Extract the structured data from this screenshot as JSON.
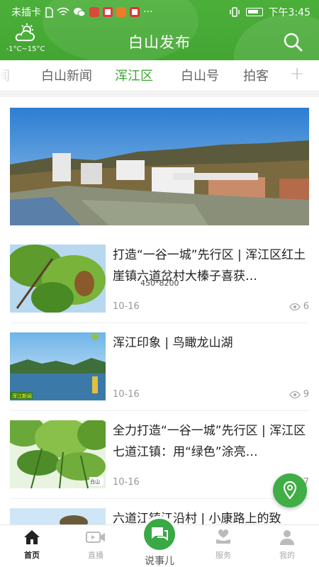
{
  "status_bar": {
    "carrier": "未插卡",
    "dots": "···",
    "time": "下午3:45"
  },
  "weather": {
    "icon": "cloud-sun-icon",
    "temp_range": "-1°C~15°C"
  },
  "header": {
    "title": "白山发布"
  },
  "tabs": {
    "items": [
      {
        "label": "闻"
      },
      {
        "label": "白山新闻"
      },
      {
        "label": "浑江区",
        "active": true
      },
      {
        "label": "白山号"
      },
      {
        "label": "拍客"
      }
    ],
    "plus": "+"
  },
  "news": [
    {
      "title": "打造“一谷一城”先行区 | 浑江区红土崖镇六道岔村大榛子喜获…",
      "date": "10-16",
      "views": "6"
    },
    {
      "title": "浑江印象 | 鸟瞰龙山湖",
      "date": "10-16",
      "views": "9"
    },
    {
      "title": "全力打造“一谷一城”先行区 | 浑江区七道江镇：用“绿色”涂亮…",
      "date": "10-16",
      "views": "7"
    },
    {
      "title": "六道江镇江沿村 | 小康路上的致",
      "date": "",
      "views": ""
    }
  ],
  "thumb_text": {
    "video_badge": "浑江新闻",
    "corner_label": "白山"
  },
  "watermark": "450*8200",
  "bottom_nav": {
    "home": "首页",
    "live": "直播",
    "center": "说事儿",
    "service": "服务",
    "mine": "我的"
  },
  "colors": {
    "brand_green": "#43a632",
    "active_tab": "#3fa535"
  }
}
